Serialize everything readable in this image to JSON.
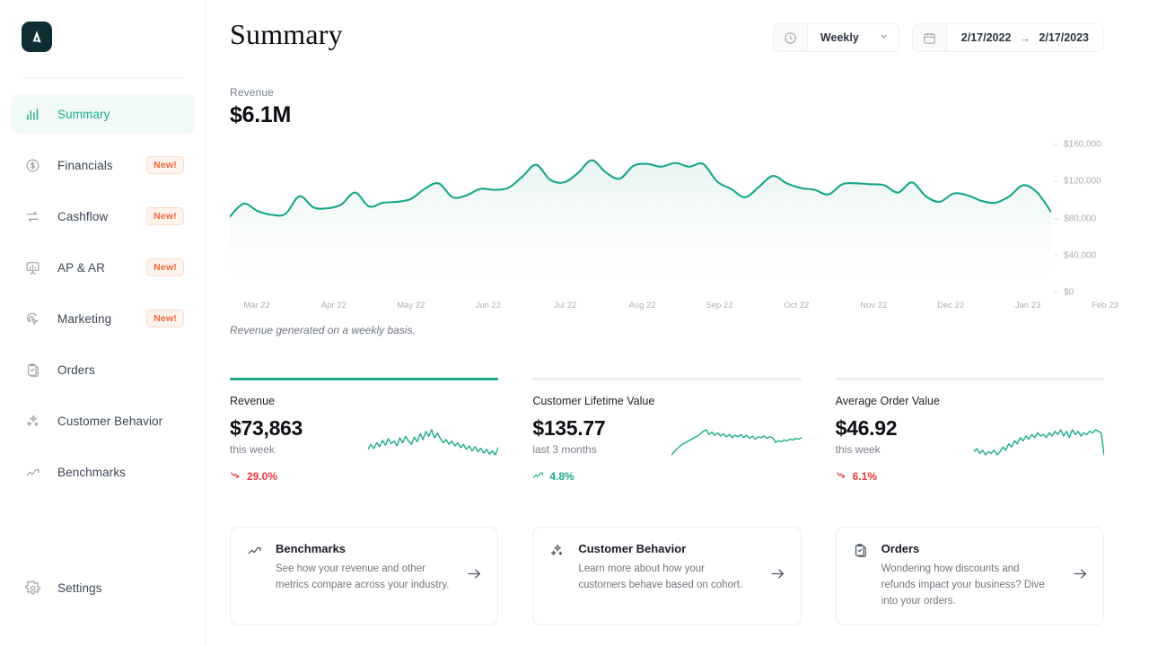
{
  "brand": {
    "logo_letter": "A",
    "logo_bg": "#0f2e33",
    "accent": "#1bab8a"
  },
  "sidebar": {
    "items": [
      {
        "label": "Summary",
        "icon": "bar-chart-icon",
        "badge": "",
        "active": true
      },
      {
        "label": "Financials",
        "icon": "dollar-circle-icon",
        "badge": "New!",
        "active": false
      },
      {
        "label": "Cashflow",
        "icon": "exchange-arrows-icon",
        "badge": "New!",
        "active": false
      },
      {
        "label": "AP & AR",
        "icon": "presentation-icon",
        "badge": "New!",
        "active": false
      },
      {
        "label": "Marketing",
        "icon": "click-target-icon",
        "badge": "New!",
        "active": false
      },
      {
        "label": "Orders",
        "icon": "clipboard-check-icon",
        "badge": "",
        "active": false
      },
      {
        "label": "Customer Behavior",
        "icon": "sparkles-icon",
        "badge": "",
        "active": false
      },
      {
        "label": "Benchmarks",
        "icon": "trend-up-icon",
        "badge": "",
        "active": false
      }
    ],
    "settings": {
      "label": "Settings",
      "icon": "gear-icon"
    }
  },
  "header": {
    "title": "Summary",
    "interval": {
      "icon": "clock-icon",
      "value": "Weekly",
      "chevron": "chevron-down-icon"
    },
    "date_range": {
      "icon": "calendar-icon",
      "start": "2/17/2022",
      "arrow": "→",
      "end": "2/17/2023"
    }
  },
  "revenue_header": {
    "label": "Revenue",
    "value": "$6.1M"
  },
  "chart_caption": "Revenue generated on a weekly basis.",
  "chart_data": {
    "type": "area",
    "title": "Revenue",
    "xlabel": "",
    "ylabel": "",
    "ylim": [
      0,
      160000
    ],
    "grid": false,
    "legend": "none",
    "line_color": "#17a589",
    "fill_color": "#e6f4ef",
    "y_ticks": [
      "$0",
      "$40,000",
      "$80,000",
      "$120,000",
      "$160,000"
    ],
    "y_tick_values": [
      0,
      40000,
      80000,
      120000,
      160000
    ],
    "categories": [
      "Mar 22",
      "Apr 22",
      "May 22",
      "Jun 22",
      "Jul 22",
      "Aug 22",
      "Sep 22",
      "Oct 22",
      "Nov 22",
      "Dec 22",
      "Jan 23",
      "Feb 23"
    ],
    "values": [
      82000,
      96000,
      88000,
      84000,
      85000,
      104000,
      92000,
      91000,
      95000,
      108000,
      93000,
      97000,
      98000,
      101000,
      112000,
      118000,
      103000,
      105000,
      112000,
      111000,
      113000,
      125000,
      138000,
      122000,
      119000,
      129000,
      143000,
      130000,
      123000,
      137000,
      139000,
      136000,
      140000,
      136000,
      139000,
      120000,
      112000,
      103000,
      114000,
      126000,
      118000,
      113000,
      111000,
      106000,
      117000,
      118000,
      117000,
      116000,
      108000,
      119000,
      104000,
      98000,
      107000,
      105000,
      99000,
      97000,
      104000,
      116000,
      108000,
      87000
    ]
  },
  "metrics": [
    {
      "title": "Revenue",
      "value": "$73,863",
      "period": "this week",
      "delta": "29.0%",
      "direction": "down",
      "active_bar": true,
      "spark": [
        14,
        20,
        15,
        22,
        17,
        25,
        19,
        27,
        21,
        24,
        18,
        28,
        22,
        30,
        24,
        20,
        29,
        23,
        33,
        26,
        36,
        30,
        38,
        28,
        34,
        27,
        22,
        26,
        20,
        24,
        18,
        22,
        16,
        20,
        14,
        18,
        12,
        17,
        11,
        15,
        9,
        14,
        8,
        12,
        7,
        16
      ]
    },
    {
      "title": "Customer Lifetime Value",
      "value": "$135.77",
      "period": "last 3 months",
      "delta": "4.8%",
      "direction": "up",
      "active_bar": false,
      "spark": [
        4,
        8,
        12,
        15,
        18,
        20,
        22,
        24,
        26,
        28,
        31,
        34,
        36,
        30,
        33,
        29,
        32,
        28,
        31,
        27,
        30,
        26,
        29,
        27,
        30,
        26,
        29,
        25,
        28,
        24,
        27,
        26,
        28,
        25,
        27,
        26,
        20,
        22,
        21,
        23,
        22,
        24,
        23,
        25,
        24,
        26
      ]
    },
    {
      "title": "Average Order Value",
      "value": "$46.92",
      "period": "this week",
      "delta": "6.1%",
      "direction": "down",
      "active_bar": false,
      "spark": [
        14,
        16,
        13,
        15,
        12,
        14,
        13,
        15,
        12,
        14,
        17,
        15,
        19,
        17,
        21,
        19,
        23,
        21,
        24,
        22,
        25,
        23,
        26,
        24,
        25,
        23,
        26,
        24,
        27,
        25,
        28,
        24,
        27,
        23,
        28,
        25,
        27,
        24,
        26,
        25,
        27,
        26,
        28,
        27,
        26,
        12
      ]
    }
  ],
  "link_cards": [
    {
      "title": "Benchmarks",
      "icon": "trend-up-icon",
      "description": "See how your revenue and other metrics compare across your industry.",
      "arrow": "arrow-right-icon"
    },
    {
      "title": "Customer Behavior",
      "icon": "sparkles-icon",
      "description": "Learn more about how your customers behave based on cohort.",
      "arrow": "arrow-right-icon"
    },
    {
      "title": "Orders",
      "icon": "clipboard-check-icon",
      "description": "Wondering how discounts and refunds impact your business? Dive into your orders.",
      "arrow": "arrow-right-icon"
    }
  ]
}
